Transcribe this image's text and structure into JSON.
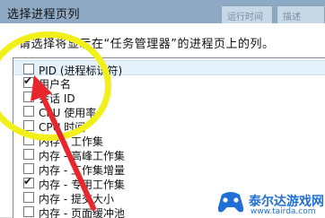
{
  "window": {
    "title": "选择进程页列",
    "background_tabs": [
      "运行时间",
      "描述"
    ]
  },
  "instruction": "请选择将显示在“任务管理器”的进程页上的列。",
  "columns": [
    {
      "label": "PID (进程标识符)",
      "checked": false,
      "selected": true
    },
    {
      "label": "用户名",
      "checked": true,
      "selected": false
    },
    {
      "label": "会话 ID",
      "checked": false,
      "selected": false
    },
    {
      "label": "CPU 使用率",
      "checked": false,
      "selected": false
    },
    {
      "label": "CPU 时间",
      "checked": false,
      "selected": false
    },
    {
      "label": "内存 - 工作集",
      "checked": false,
      "selected": false
    },
    {
      "label": "内存 - 高峰工作集",
      "checked": false,
      "selected": false
    },
    {
      "label": "内存 - 工作集增量",
      "checked": false,
      "selected": false
    },
    {
      "label": "内存 - 专用工作集",
      "checked": true,
      "selected": false
    },
    {
      "label": "内存 - 提交大小",
      "checked": false,
      "selected": false
    },
    {
      "label": "内存 - 页面缓冲池",
      "checked": false,
      "selected": false
    }
  ],
  "watermark": {
    "title": "泰尔达游戏网",
    "url": "www.tairda.com"
  },
  "colors": {
    "highlight_circle": "#f2f01a",
    "arrow": "#e8262d",
    "watermark": "#1f6fd6"
  }
}
